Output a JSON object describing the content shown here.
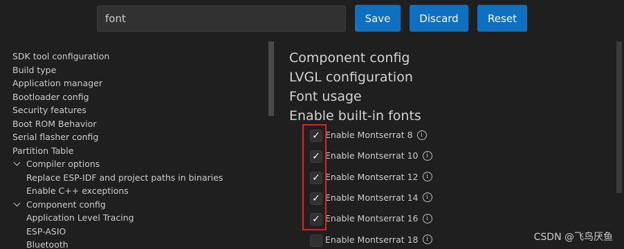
{
  "search": {
    "value": "font"
  },
  "buttons": {
    "save": "Save",
    "discard": "Discard",
    "reset": "Reset"
  },
  "tree": [
    {
      "label": "SDK tool configuration",
      "indent": 0,
      "expandable": false
    },
    {
      "label": "Build type",
      "indent": 0,
      "expandable": false
    },
    {
      "label": "Application manager",
      "indent": 0,
      "expandable": false
    },
    {
      "label": "Bootloader config",
      "indent": 0,
      "expandable": false
    },
    {
      "label": "Security features",
      "indent": 0,
      "expandable": false
    },
    {
      "label": "Boot ROM Behavior",
      "indent": 0,
      "expandable": false
    },
    {
      "label": "Serial flasher config",
      "indent": 0,
      "expandable": false
    },
    {
      "label": "Partition Table",
      "indent": 0,
      "expandable": false
    },
    {
      "label": "Compiler options",
      "indent": 1,
      "expandable": true
    },
    {
      "label": "Replace ESP-IDF and project paths in binaries",
      "indent": 2,
      "expandable": false
    },
    {
      "label": "Enable C++ exceptions",
      "indent": 2,
      "expandable": false
    },
    {
      "label": "Component config",
      "indent": 1,
      "expandable": true
    },
    {
      "label": "Application Level Tracing",
      "indent": 2,
      "expandable": false
    },
    {
      "label": "ESP-ASIO",
      "indent": 2,
      "expandable": false
    },
    {
      "label": "Bluetooth",
      "indent": 2,
      "expandable": false
    }
  ],
  "headings": [
    "Component config",
    "LVGL configuration",
    "Font usage",
    "Enable built-in fonts"
  ],
  "fonts": [
    {
      "label": "Enable Montserrat 8",
      "checked": true
    },
    {
      "label": "Enable Montserrat 10",
      "checked": true
    },
    {
      "label": "Enable Montserrat 12",
      "checked": true
    },
    {
      "label": "Enable Montserrat 14",
      "checked": true
    },
    {
      "label": "Enable Montserrat 16",
      "checked": true
    },
    {
      "label": "Enable Montserrat 18",
      "checked": false
    }
  ],
  "icons": {
    "checkmark": "✓",
    "info": "i",
    "chevron": "chevron-down-icon"
  },
  "watermark": "CSDN @飞鸟厌鱼",
  "colors": {
    "accent": "#0e70c0",
    "highlight": "#e0232b",
    "background": "#1f1f1f"
  }
}
